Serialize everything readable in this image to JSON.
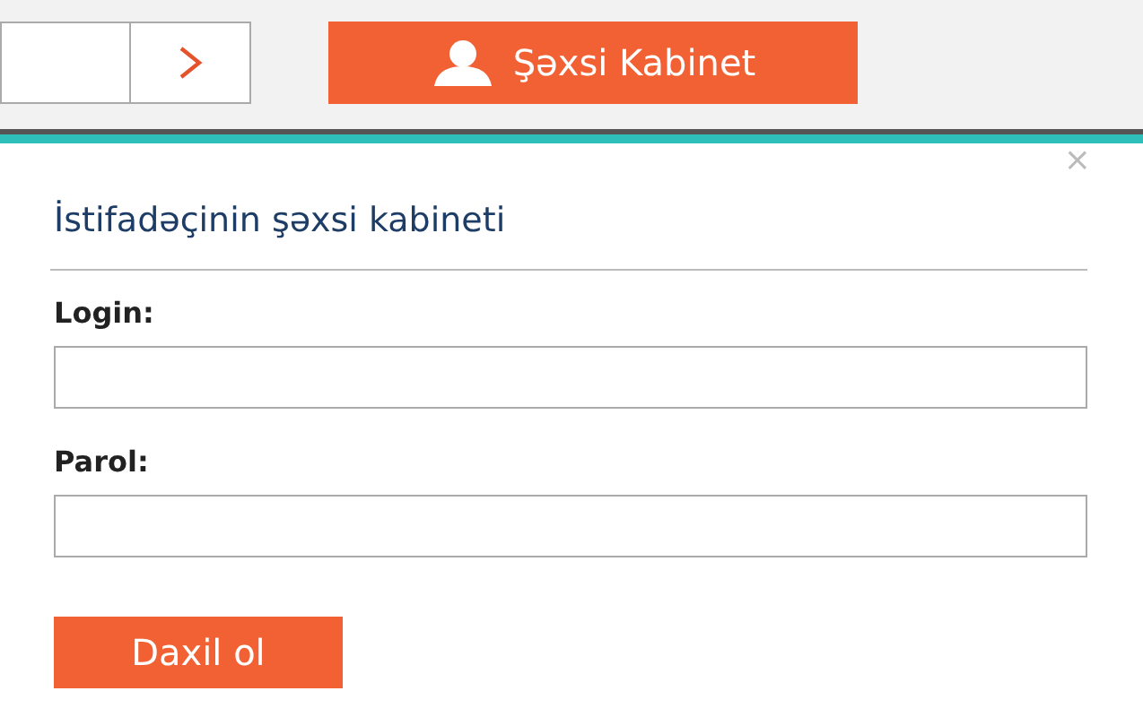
{
  "header": {
    "cabinet_button": "Şəxsi Kabinet"
  },
  "dialog": {
    "close": "×",
    "title": "İstifadəçinin şəxsi kabineti",
    "fields": [
      {
        "label": "Login:"
      },
      {
        "label": "Parol:"
      }
    ],
    "submit": "Daxil ol"
  }
}
